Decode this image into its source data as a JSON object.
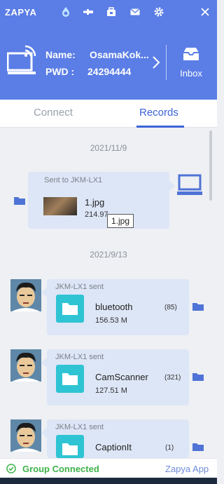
{
  "app": {
    "logo": "ZAPYA"
  },
  "device": {
    "name_label": "Name:",
    "name_value": "OsamaKok...",
    "pwd_label": "PWD :",
    "pwd_value": "24294444",
    "inbox_label": "Inbox"
  },
  "tabs": {
    "connect": "Connect",
    "records": "Records"
  },
  "records": {
    "group1": {
      "date": "2021/11/9",
      "sent_to": "Sent to JKM-LX1",
      "file_name": "1.jpg",
      "file_size": "214.97",
      "tooltip": "1.jpg"
    },
    "group2": {
      "date": "2021/9/13",
      "items": [
        {
          "sender": "JKM-LX1 sent",
          "name": "bluetooth",
          "size": "156.53 M",
          "count": "(85)"
        },
        {
          "sender": "JKM-LX1 sent",
          "name": "CamScanner",
          "size": "127.51 M",
          "count": "(321)"
        },
        {
          "sender": "JKM-LX1 sent",
          "name": "CaptionIt",
          "size": "",
          "count": "(1)"
        }
      ]
    }
  },
  "status": {
    "text": "Group Connected",
    "app_link": "Zapya App"
  },
  "colors": {
    "header": "#5a7de6",
    "accent": "#3b63d8",
    "folder": "#2fc4d4",
    "connected": "#3fb24a"
  }
}
